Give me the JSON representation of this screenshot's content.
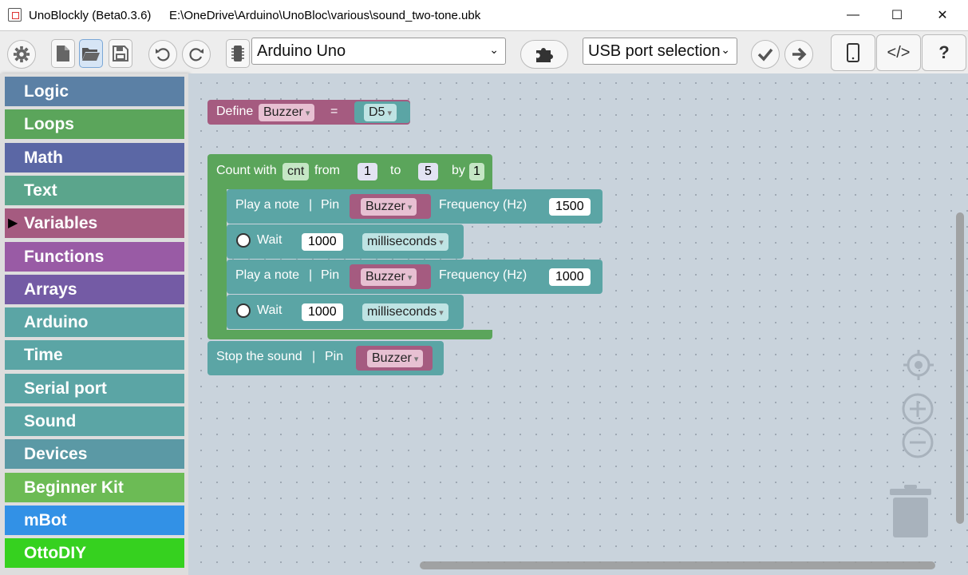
{
  "window": {
    "app_title": "UnoBlockly (Beta0.3.6)",
    "file_path": "E:\\OneDrive\\Arduino\\UnoBloc\\various\\sound_two-tone.ubk",
    "min_glyph": "—",
    "max_glyph": "☐",
    "close_glyph": "✕"
  },
  "toolbar": {
    "board_select": "Arduino Uno",
    "port_select": "USB port selection",
    "chevron": "⌄",
    "icons": [
      "gear-icon",
      "new-file-icon",
      "open-folder-icon",
      "save-icon",
      "undo-icon",
      "redo-icon",
      "chip-icon",
      "puzzle-icon",
      "check-icon",
      "arrow-right-icon",
      "tablet-icon",
      "code-icon",
      "help-icon"
    ],
    "help_label": "?",
    "code_label": "</>"
  },
  "categories": [
    {
      "label": "Logic",
      "color": "#5b80a5"
    },
    {
      "label": "Loops",
      "color": "#5ba55b"
    },
    {
      "label": "Math",
      "color": "#5b67a5"
    },
    {
      "label": "Text",
      "color": "#5ba58c"
    },
    {
      "label": "Variables",
      "color": "#a55b80",
      "selected": true
    },
    {
      "label": "Functions",
      "color": "#995ba5"
    },
    {
      "label": "Arrays",
      "color": "#745ba5"
    },
    {
      "label": "Arduino",
      "color": "#5ba5a5"
    },
    {
      "label": "Time",
      "color": "#5ba5a5"
    },
    {
      "label": "Serial port",
      "color": "#5ba5a5"
    },
    {
      "label": "Sound",
      "color": "#5ba5a5"
    },
    {
      "label": "Devices",
      "color": "#5b99a5"
    },
    {
      "label": "Beginner Kit",
      "color": "#6cbb55"
    },
    {
      "label": "mBot",
      "color": "#3291e6"
    },
    {
      "label": "OttoDIY",
      "color": "#36d11f"
    }
  ],
  "blocks": {
    "define": {
      "label": "Define",
      "var": "Buzzer",
      "eq": "=",
      "pin": "D5",
      "color": "#a55b80",
      "pin_color": "#5ba5a5"
    },
    "loop": {
      "label": "Count with",
      "var": "cnt",
      "from_label": "from",
      "from": "1",
      "to_label": "to",
      "to": "5",
      "by_label": "by",
      "by": "1",
      "color": "#5ba55b"
    },
    "note1": {
      "label": "Play a note",
      "sep": "|",
      "pin_label": "Pin",
      "pin": "Buzzer",
      "freq_label": "Frequency (Hz)",
      "freq": "1500"
    },
    "wait1": {
      "label": "Wait",
      "value": "1000",
      "unit": "milliseconds"
    },
    "note2": {
      "label": "Play a note",
      "sep": "|",
      "pin_label": "Pin",
      "pin": "Buzzer",
      "freq_label": "Frequency (Hz)",
      "freq": "1000"
    },
    "wait2": {
      "label": "Wait",
      "value": "1000",
      "unit": "milliseconds"
    },
    "stop": {
      "label": "Stop the sound",
      "sep": "|",
      "pin_label": "Pin",
      "pin": "Buzzer"
    },
    "sound_color": "#5ba5a5"
  }
}
